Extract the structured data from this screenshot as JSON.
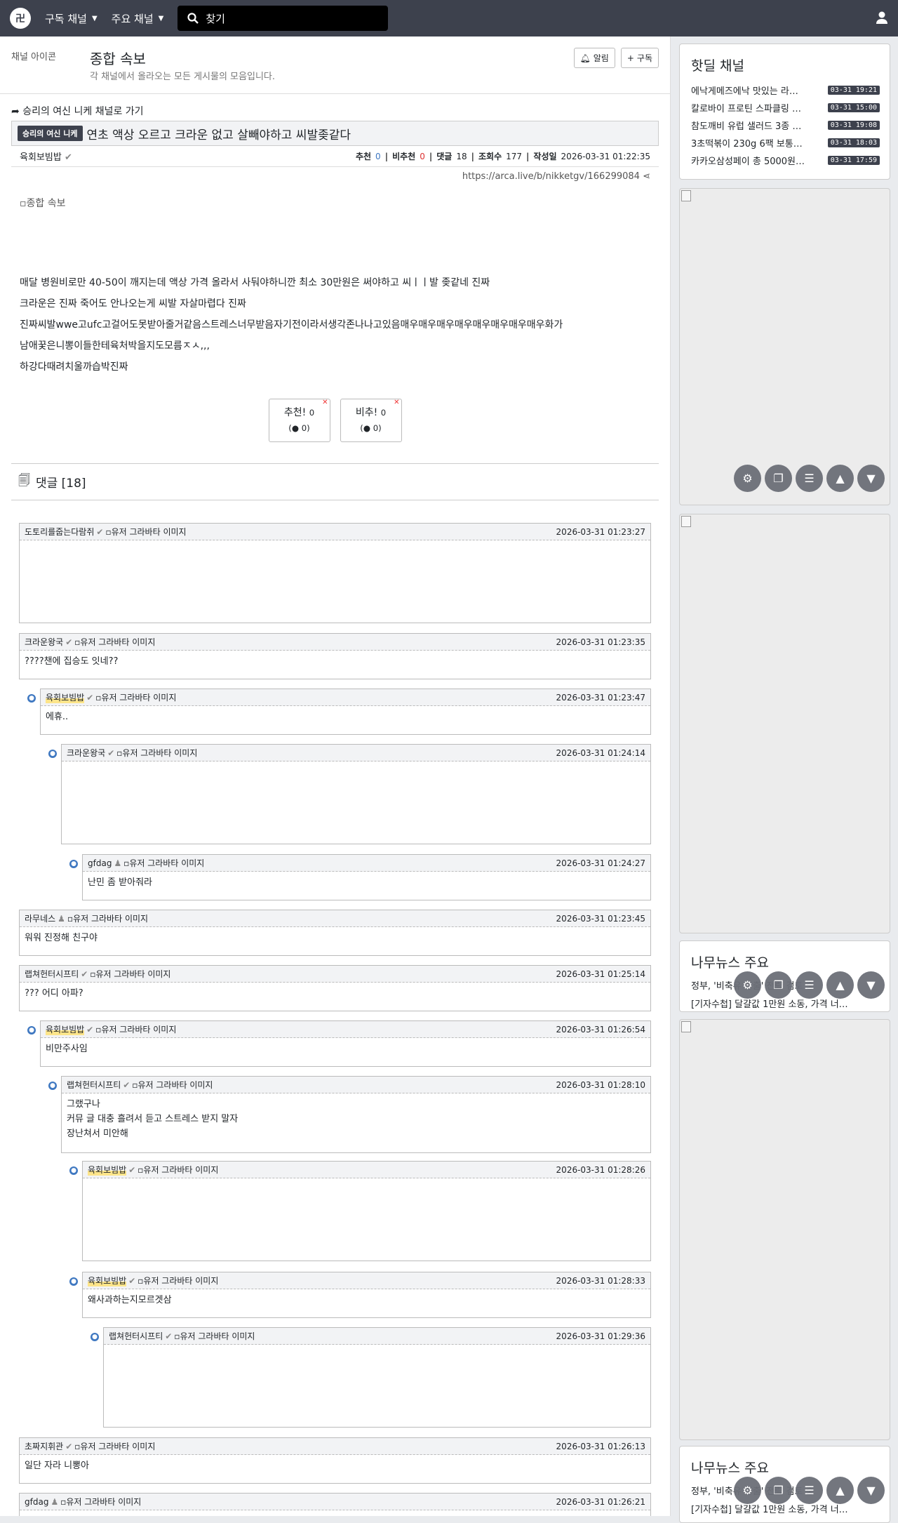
{
  "navbar": {
    "menu1": "구독 채널",
    "menu2": "주요 채널",
    "search_placeholder": "찾기"
  },
  "channel": {
    "icon_alt": "채널 아이콘",
    "title": "종합 속보",
    "subtitle": "각 채널에서 올라오는 모든 게시물의 모음입니다.",
    "alarm_label": "알림",
    "subscribe_label": "구독"
  },
  "article": {
    "goto_text": "승리의 여신 니케 채널로 가기",
    "badge": "승리의 여신 니케",
    "title": "연초 액상 오르고 크라운 없고 살빼야하고 씨발좆같다",
    "author": "육회보빔밥",
    "rec_label": "추천",
    "rec": "0",
    "unrec_label": "비추천",
    "unrec": "0",
    "cmt_label": "댓글",
    "cmt": "18",
    "views_label": "조회수",
    "views": "177",
    "date_label": "작성일",
    "date": "2026-03-31 01:22:35",
    "url": "https://arca.live/b/nikketgv/166299084",
    "img_alt": "종합 속보",
    "lines": [
      "매달 병원비로만 40-50이 깨지는데 액상 가격 올라서 사둬야하니깐 최소 30만원은 써야하고 씨ㅣㅣ발 좆같네 진짜",
      "크라운은 진짜 죽어도 안나오는게 씨발 자살마렵다 진짜",
      "진짜씨발wwe고ufc고걸어도못받아줄거같음스트레스너무받음자기전이라서생각존나나고있음매우매우매우매우매우매우매우매우화가",
      "남애꿎은니뽕이들한테육처박을지도모름ㅈㅅ,,,",
      "하강다때려치울까습박진짜"
    ],
    "vote_up": "추천!",
    "vote_up_num": "0",
    "vote_up_sub": "0",
    "vote_down": "비추!",
    "vote_down_num": "0",
    "vote_down_sub": "0"
  },
  "comments_header": "댓글 [18]",
  "avatar_alt": "유저 그라바타 이미지",
  "comments": [
    {
      "author": "도토리를줍는다람쥐",
      "date": "2026-03-31 01:23:27",
      "body": ""
    },
    {
      "author": "크라운왕국",
      "date": "2026-03-31 01:23:35",
      "body": "????챈에 집승도 잇네??"
    },
    {
      "author": "육회보빔밥",
      "date": "2026-03-31 01:23:47",
      "body": "에휴.."
    },
    {
      "author": "크라운왕국",
      "date": "2026-03-31 01:24:14",
      "body": ""
    },
    {
      "author": "gfdag",
      "date": "2026-03-31 01:24:27",
      "body": "난민 좀 받아줘라"
    },
    {
      "author": "라무네스",
      "date": "2026-03-31 01:23:45",
      "body": "워워 진정해 친구야"
    },
    {
      "author": "랩쳐헌터시프티",
      "date": "2026-03-31 01:25:14",
      "body": "??? 어디 아파?"
    },
    {
      "author": "육회보빔밥",
      "date": "2026-03-31 01:26:54",
      "body": "비만주사임"
    },
    {
      "author": "랩쳐헌터시프티",
      "date": "2026-03-31 01:28:10",
      "body": "그랬구나\n커뮤 글 대충 흘려서 듣고 스트레스 받지 말자\n장난쳐서 미안해"
    },
    {
      "author": "육회보빔밥",
      "date": "2026-03-31 01:28:26",
      "body": ""
    },
    {
      "author": "육회보빔밥",
      "date": "2026-03-31 01:28:33",
      "body": "왜사과하는지모르겟삼"
    },
    {
      "author": "랩쳐헌터시프티",
      "date": "2026-03-31 01:29:36",
      "body": ""
    },
    {
      "author": "초짜지휘관",
      "date": "2026-03-31 01:26:13",
      "body": "일단 자라 니뽕아"
    },
    {
      "author": "gfdag",
      "date": "2026-03-31 01:26:21",
      "body": ""
    }
  ],
  "sidebar": {
    "hot_title": "핫딜 채널",
    "hot": [
      {
        "title": "에낙게메즈에낙 맛있는 라…",
        "time": "03-31 19:21"
      },
      {
        "title": "칼로바이 프로틴 스파클링 …",
        "time": "03-31 15:00"
      },
      {
        "title": "참도깨비 유럽 샐러드 3종 …",
        "time": "03-31 19:08"
      },
      {
        "title": "3초떡볶이 230g 6팩 보통…",
        "time": "03-31 18:03"
      },
      {
        "title": "카카오삼성페이 총 5000원…",
        "time": "03-31 17:59"
      }
    ],
    "news_title": "나무뉴스 주요",
    "news": [
      "정부, '비축유 방출' 전략 검토 중",
      "[기자수첩] 달걀값 1만원 소동, 가격 너…"
    ]
  },
  "colors": {
    "navbar": "#3d414d",
    "accent": "#3f78c1",
    "badge": "#3d414d"
  }
}
